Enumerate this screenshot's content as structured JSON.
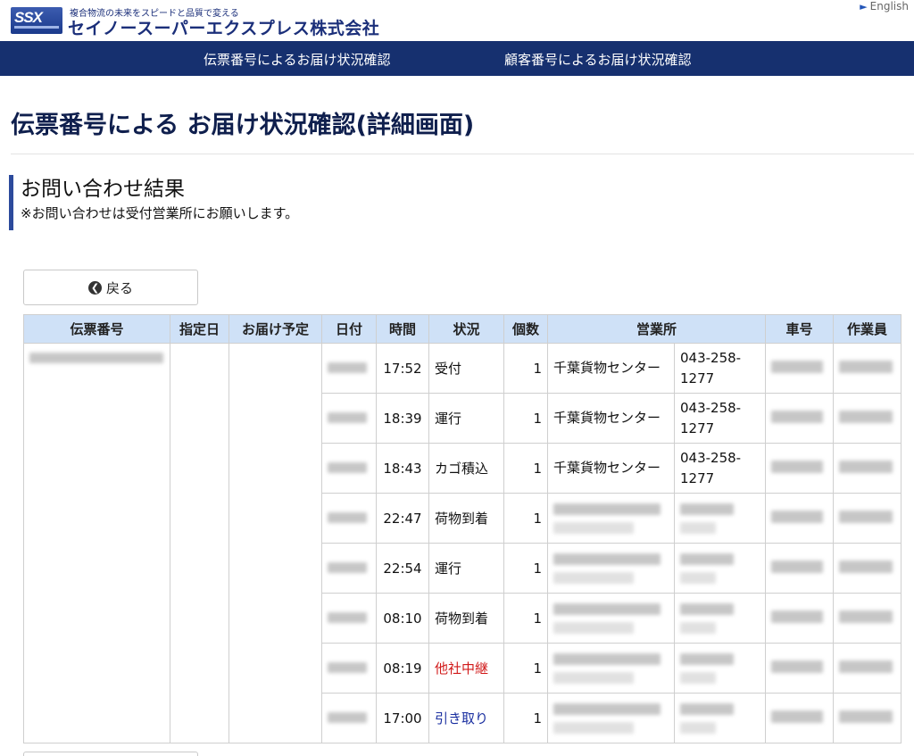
{
  "header": {
    "logo_mark": "SSX",
    "tagline": "複合物流の未来をスピードと品質で変える",
    "company": "セイノースーパーエクスプレス株式会社",
    "language_link": "English"
  },
  "nav": {
    "items": [
      {
        "label": "伝票番号によるお届け状況確認"
      },
      {
        "label": "顧客番号によるお届け状況確認"
      }
    ]
  },
  "page_title": "伝票番号による お届け状況確認(詳細画面)",
  "section": {
    "title": "お問い合わせ結果",
    "note": "※お問い合わせは受付営業所にお願いします。"
  },
  "back_button": {
    "label": "戻る",
    "icon": "arrow-left-circle-icon"
  },
  "table": {
    "headers": {
      "slip": "伝票番号",
      "designated_date": "指定日",
      "delivery_plan": "お届け予定",
      "date": "日付",
      "time": "時間",
      "status": "状況",
      "count": "個数",
      "office": "営業所",
      "vehicle": "車号",
      "worker": "作業員"
    },
    "rows": [
      {
        "time": "17:52",
        "status": "受付",
        "count": "1",
        "office": "千葉貨物センター",
        "phone": "043-258-1277",
        "status_color": "#111111"
      },
      {
        "time": "18:39",
        "status": "運行",
        "count": "1",
        "office": "千葉貨物センター",
        "phone": "043-258-1277",
        "status_color": "#111111"
      },
      {
        "time": "18:43",
        "status": "カゴ積込",
        "count": "1",
        "office": "千葉貨物センター",
        "phone": "043-258-1277",
        "status_color": "#111111"
      },
      {
        "time": "22:47",
        "status": "荷物到着",
        "count": "1",
        "status_color": "#111111"
      },
      {
        "time": "22:54",
        "status": "運行",
        "count": "1",
        "status_color": "#111111"
      },
      {
        "time": "08:10",
        "status": "荷物到着",
        "count": "1",
        "status_color": "#111111"
      },
      {
        "time": "08:19",
        "status": "他社中継",
        "count": "1",
        "status_color": "#d11a1a"
      },
      {
        "time": "17:00",
        "status": "引き取り",
        "count": "1",
        "status_color": "#1a2fa0"
      }
    ]
  }
}
